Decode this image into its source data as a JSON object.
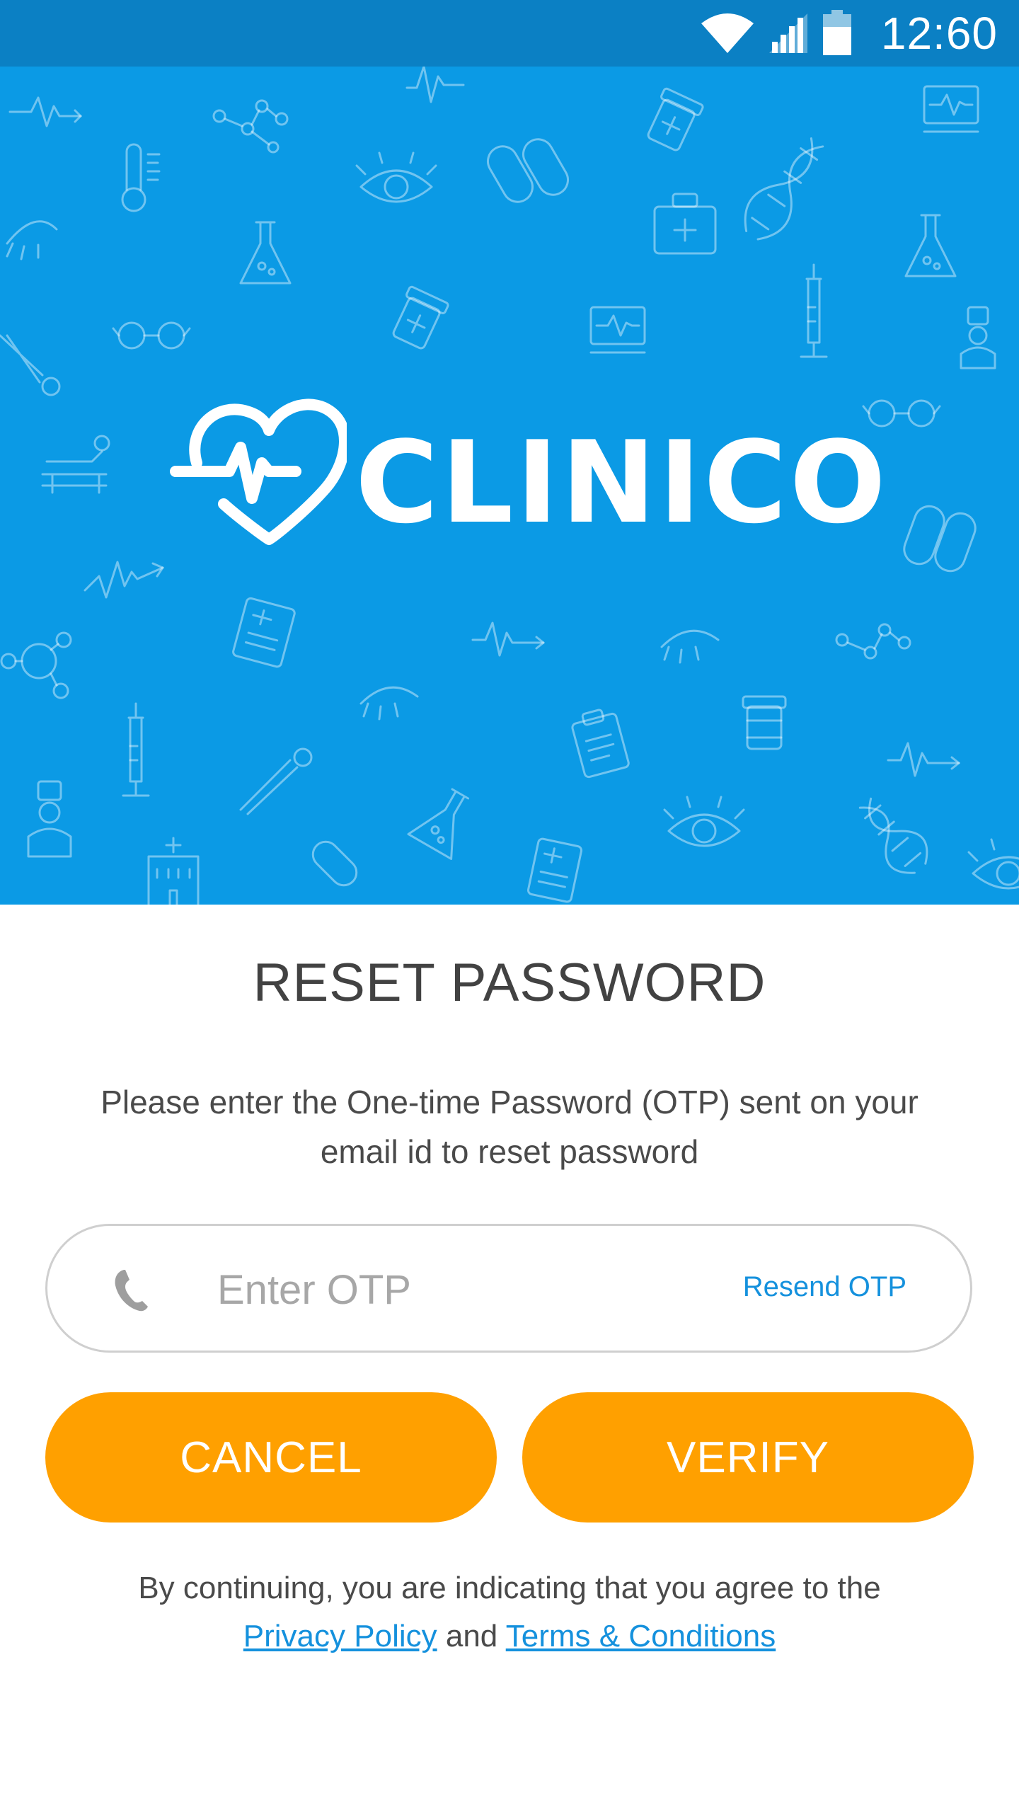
{
  "status_bar": {
    "time": "12:60",
    "icons": [
      "wifi-icon",
      "cell-signal-icon",
      "battery-icon"
    ]
  },
  "brand": {
    "name": "CLINICO",
    "logo_icon": "heart-pulse-icon"
  },
  "hero": {
    "background_color": "#0b9ae5",
    "pattern_icons": [
      "heartbeat-icon",
      "molecule-icon",
      "pill-bottle-icon",
      "monitor-icon",
      "thermometer-icon",
      "capsule-icon",
      "eye-icon",
      "dna-icon",
      "first-aid-kit-icon",
      "flask-icon",
      "syringe-icon",
      "glasses-icon",
      "scissors-icon",
      "doctor-icon",
      "hospital-bed-icon",
      "clipboard-icon",
      "hospital-icon"
    ]
  },
  "reset": {
    "title": "RESET PASSWORD",
    "instructions_line1": "Please enter the One-time Password (OTP) sent on your",
    "instructions_line2": "email id to reset password",
    "otp_placeholder": "Enter OTP",
    "otp_value": "",
    "otp_icon": "phone-icon",
    "resend_label": "Resend OTP",
    "cancel_label": "CANCEL",
    "verify_label": "VERIFY"
  },
  "terms": {
    "line1": "By continuing, you are indicating that you agree to the",
    "privacy_label": "Privacy Policy",
    "and_label": "and",
    "terms_label": "Terms & Conditions"
  },
  "colors": {
    "status_bar": "#0b80c4",
    "hero": "#0b9ae5",
    "accent_button": "#ffa000",
    "link": "#1591dd",
    "title_text": "#424242"
  }
}
